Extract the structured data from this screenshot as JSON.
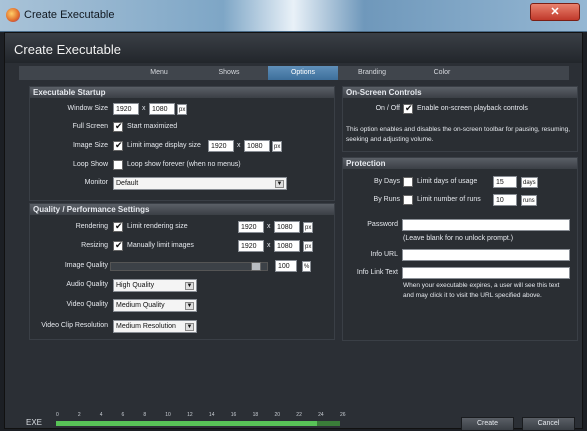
{
  "window": {
    "title": "Create Executable",
    "close_label": "✕"
  },
  "header": {
    "title": "Create Executable"
  },
  "tabs": [
    {
      "label": "Menu"
    },
    {
      "label": "Shows"
    },
    {
      "label": "Options"
    },
    {
      "label": "Branding"
    },
    {
      "label": "Color"
    }
  ],
  "startup": {
    "title": "Executable Startup",
    "window_size": {
      "label": "Window Size",
      "width": "1920",
      "height": "1080",
      "unit": "px"
    },
    "full_screen": {
      "label": "Full Screen",
      "checked": true,
      "text": "Start maximized"
    },
    "image_size": {
      "label": "Image Size",
      "checked": true,
      "text": "Limit image display size",
      "width": "1920",
      "height": "1080",
      "unit": "px"
    },
    "loop_show": {
      "label": "Loop Show",
      "checked": false,
      "text": "Loop show forever (when no menus)"
    },
    "monitor": {
      "label": "Monitor",
      "value": "Default"
    }
  },
  "quality": {
    "title": "Quality / Performance Settings",
    "rendering": {
      "label": "Rendering",
      "checked": true,
      "text": "Limit rendering size",
      "width": "1920",
      "height": "1080",
      "unit": "px"
    },
    "resizing": {
      "label": "Resizing",
      "checked": true,
      "text": "Manually limit images",
      "width": "1920",
      "height": "1080",
      "unit": "px"
    },
    "image_quality": {
      "label": "Image Quality",
      "value": "100",
      "unit": "%",
      "level": 1.0
    },
    "audio_quality": {
      "label": "Audio Quality",
      "value": "High Quality"
    },
    "video_quality": {
      "label": "Video Quality",
      "value": "Medium Quality"
    },
    "video_clip": {
      "label": "Video Clip Resolution",
      "value": "Medium Resolution"
    }
  },
  "onscreen": {
    "title": "On-Screen Controls",
    "label": "On / Off",
    "checked": true,
    "text": "Enable on-screen playback controls",
    "desc": "This option enables and disables the on-screen toolbar for pausing, resuming, seeking and adjusting volume."
  },
  "protection": {
    "title": "Protection",
    "by_days": {
      "label": "By Days",
      "checked": false,
      "text": "Limit days of usage",
      "value": "15",
      "unit": "days"
    },
    "by_runs": {
      "label": "By Runs",
      "checked": false,
      "text": "Limit number of runs",
      "value": "10",
      "unit": "runs"
    },
    "password": {
      "label": "Password",
      "value": "",
      "hint": "(Leave blank for no unlock prompt.)"
    },
    "info_url": {
      "label": "Info URL",
      "value": ""
    },
    "info_link": {
      "label": "Info Link Text",
      "value": ""
    },
    "expire_note": "When your executable expires, a user will see this text and may click it to visit the URL specified above."
  },
  "footer": {
    "exe_label": "EXE",
    "ruler": [
      "0",
      "2",
      "4",
      "6",
      "8",
      "10",
      "12",
      "14",
      "16",
      "18",
      "20",
      "22",
      "24",
      "26"
    ],
    "progress": 0.92,
    "create_label": "Create",
    "cancel_label": "Cancel"
  }
}
